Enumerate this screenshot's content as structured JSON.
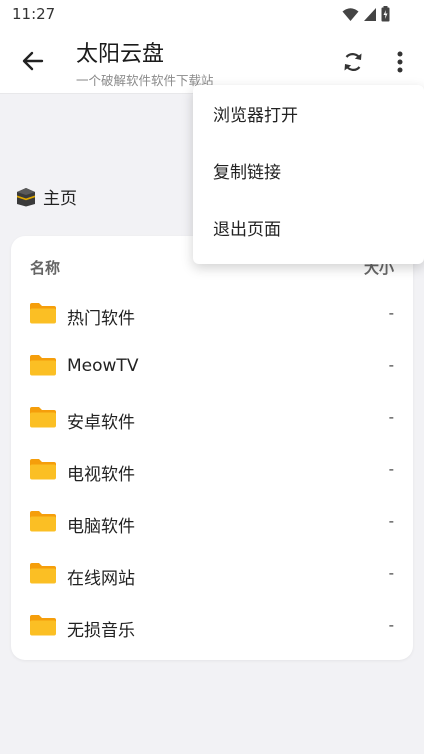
{
  "status_bar": {
    "time": "11:27"
  },
  "app_bar": {
    "title": "太阳云盘",
    "subtitle": "一个破解软件软件下载站"
  },
  "breadcrumb": {
    "label": "主页"
  },
  "table": {
    "col_name": "名称",
    "col_size": "大小",
    "rows": [
      {
        "name": "热门软件",
        "size": "-"
      },
      {
        "name": "MeowTV",
        "size": "-"
      },
      {
        "name": "安卓软件",
        "size": "-"
      },
      {
        "name": "电视软件",
        "size": "-"
      },
      {
        "name": "电脑软件",
        "size": "-"
      },
      {
        "name": "在线网站",
        "size": "-"
      },
      {
        "name": "无损音乐",
        "size": "-"
      }
    ]
  },
  "menu": {
    "items": [
      {
        "label": "浏览器打开"
      },
      {
        "label": "复制链接"
      },
      {
        "label": "退出页面"
      }
    ]
  },
  "colors": {
    "folder": "#fbbf24",
    "folder_dark": "#f59e0b",
    "background": "#f2f2f5"
  },
  "icons": [
    "wifi-icon",
    "signal-icon",
    "battery-icon",
    "back-arrow-icon",
    "refresh-icon",
    "more-vert-icon",
    "kaaba-icon",
    "folder-icon"
  ]
}
